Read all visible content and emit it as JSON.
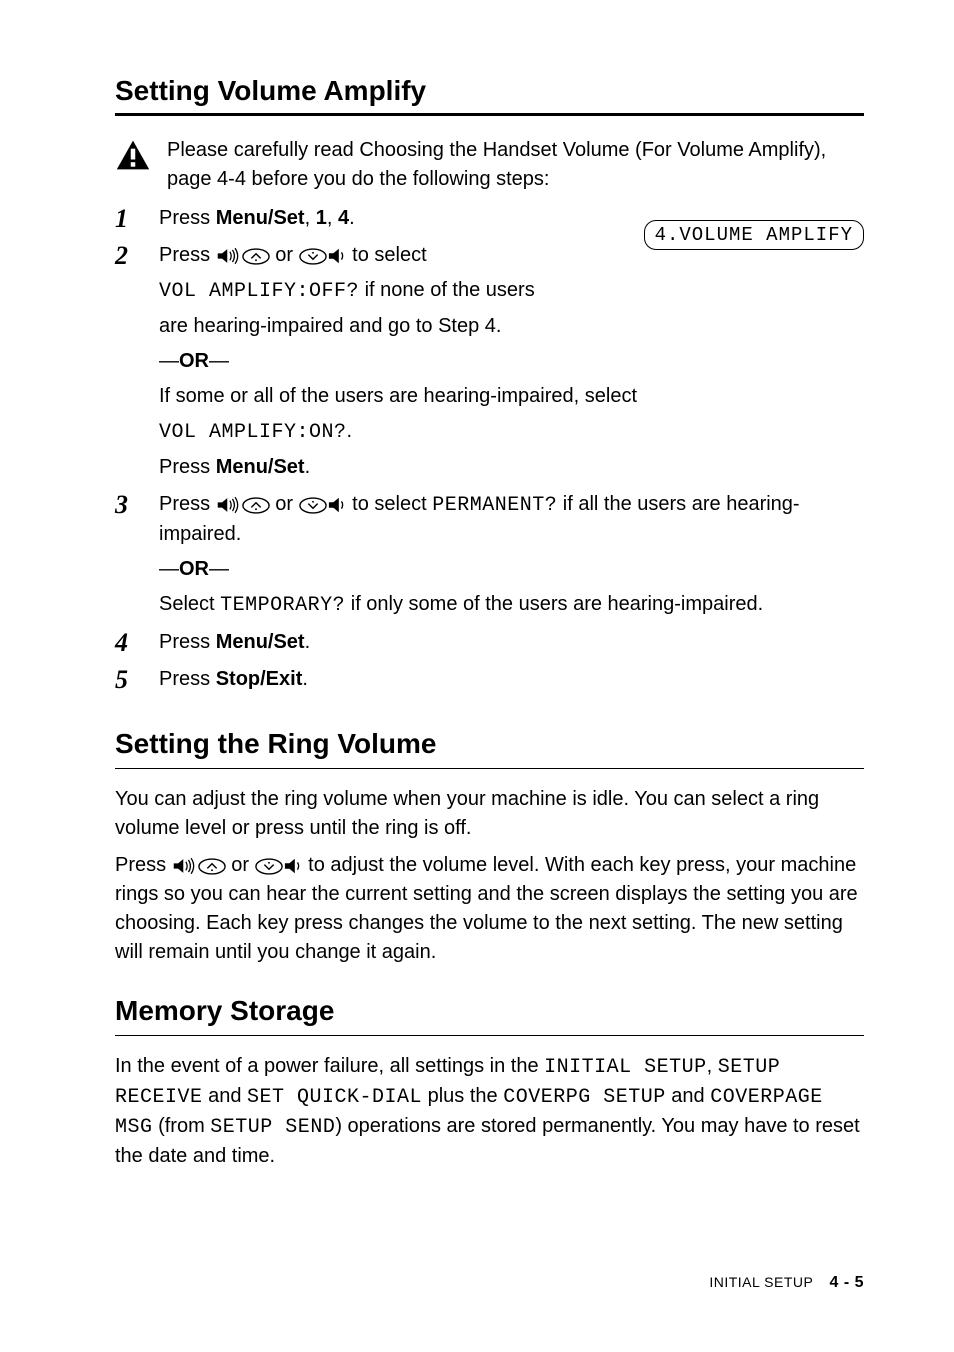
{
  "heading_amplify": "Setting Volume Amplify",
  "warn_text": "Please carefully read Choosing the Handset Volume (For Volume Amplify), page 4-4 before you do the following steps:",
  "step1": {
    "press": "Press ",
    "menuset": "Menu/Set",
    "comma1": ", ",
    "one": "1",
    "comma2": ", ",
    "four": "4",
    "period": "."
  },
  "lcd_text": "4.VOLUME AMPLIFY",
  "step2": {
    "lead": "Press ",
    "or": " or ",
    "after": " to select",
    "line2a": "VOL AMPLIFY:OFF?",
    "line2b": " if none of the users",
    "line3": "are hearing-impaired and go to Step 4.",
    "or_dash_left": "—",
    "or_word": "OR",
    "or_dash_right": "—",
    "cond_line": "If some or all of the users are hearing-impaired, select",
    "cond_code": "VOL AMPLIFY:ON?",
    "cond_period": ".",
    "press_menu": "Press ",
    "press_menu_bold": "Menu/Set",
    "press_menu_period": "."
  },
  "step3": {
    "lead": "Press ",
    "or": " or ",
    "after": " to select ",
    "perm": "PERMANENT?",
    "perm_after": " if all the users are hearing-impaired.",
    "or_dash_left": "—",
    "or_word": "OR",
    "or_dash_right": "—",
    "select": "Select ",
    "temp": "TEMPORARY?",
    "temp_after": " if only some of the users are hearing-impaired."
  },
  "step4": {
    "press": "Press ",
    "menuset": "Menu/Set",
    "period": "."
  },
  "step5": {
    "press": "Press ",
    "stopexit": "Stop/Exit",
    "period": "."
  },
  "heading_ring": "Setting the Ring Volume",
  "ring_p1": "You can adjust the ring volume when your machine is idle. You can select a ring volume level or press until the ring is off.",
  "ring_p2_a": "Press ",
  "ring_p2_or": " or ",
  "ring_p2_b": " to adjust the volume level. With each key press, your machine rings so you can hear the current setting and the screen displays the setting you are choosing. Each key press changes the volume to the next setting. The new setting will remain until you change it again.",
  "heading_memory": "Memory Storage",
  "mem_a": "In the event of a power failure, all settings in the ",
  "mem_code1": "INITIAL SETUP",
  "mem_comma": ", ",
  "mem_code2": "SETUP RECEIVE",
  "mem_and1": " and ",
  "mem_code3": "SET QUICK-DIAL",
  "mem_plus": " plus the ",
  "mem_code4": "COVERPG SETUP",
  "mem_and2": " and ",
  "mem_code5": "COVERPAGE MSG",
  "mem_from": " (from ",
  "mem_code6": "SETUP SEND",
  "mem_tail": ") operations are stored permanently. You may have to reset the date and time.",
  "footer_section": "INITIAL SETUP",
  "footer_page": "4 - 5"
}
